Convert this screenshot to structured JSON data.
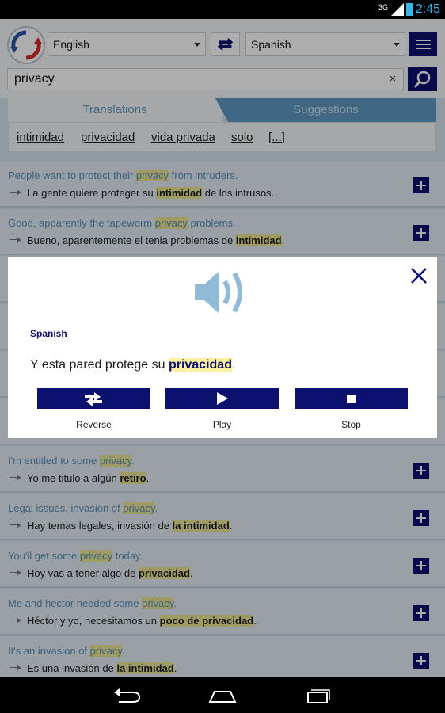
{
  "status_bar": {
    "network": "3G",
    "time": "2:45"
  },
  "header": {
    "source_language": "English",
    "target_language": "Spanish",
    "search_value": "privacy",
    "clear_symbol": "×"
  },
  "tabs": [
    {
      "label": "Translations"
    },
    {
      "label": "Suggestions"
    }
  ],
  "translations": [
    {
      "label": "intimidad"
    },
    {
      "label": "privacidad"
    },
    {
      "label": "vida privada"
    },
    {
      "label": "solo"
    },
    {
      "label": "[...]"
    }
  ],
  "examples": [
    {
      "en_before": "People want to protect their ",
      "en_hl": "privacy",
      "en_after": " from intruders.",
      "es_before": "La gente quiere proteger su ",
      "es_hl": "intimidad",
      "es_after": " de los intrusos."
    },
    {
      "en_before": "Good, apparently the tapeworm ",
      "en_hl": "privacy",
      "en_after": " problems.",
      "es_before": "Bueno, aparentemente el tenia problemas de ",
      "es_hl": "intimidad",
      "es_after": "."
    },
    {
      "en_before": "I'm entitled to some ",
      "en_hl": "privacy",
      "en_after": ".",
      "es_before": "Yo me titulo a algún ",
      "es_hl": "retiro",
      "es_after": "."
    },
    {
      "en_before": "Legal issues, invasion of ",
      "en_hl": "privacy",
      "en_after": ".",
      "es_before": "Hay temas legales, invasión de ",
      "es_hl": "la intimidad",
      "es_after": "."
    },
    {
      "en_before": "You'll get some ",
      "en_hl": "privacy",
      "en_after": " today.",
      "es_before": "Hoy vas a tener algo de ",
      "es_hl": "privacidad",
      "es_after": "."
    },
    {
      "en_before": "Me and hector needed some ",
      "en_hl": "privacy",
      "en_after": ".",
      "es_before": "Héctor y yo, necesitamos un ",
      "es_hl": "poco de privacidad",
      "es_after": "."
    },
    {
      "en_before": "It's an invasion of ",
      "en_hl": "privacy",
      "en_after": ".",
      "es_before": "Es una invasión de ",
      "es_hl": "la intimidad",
      "es_after": "."
    }
  ],
  "dialog": {
    "language": "Spanish",
    "sentence_before": "Y esta pared protege su ",
    "sentence_hl": "privacidad",
    "sentence_after": ".",
    "buttons": [
      {
        "label": "Reverse"
      },
      {
        "label": "Play"
      },
      {
        "label": "Stop"
      }
    ]
  },
  "colors": {
    "accent_dark": "#0c106f",
    "tab_active_text": "#5d9ac4",
    "highlight": "#e9e596",
    "status_blue": "#33b5e5"
  }
}
